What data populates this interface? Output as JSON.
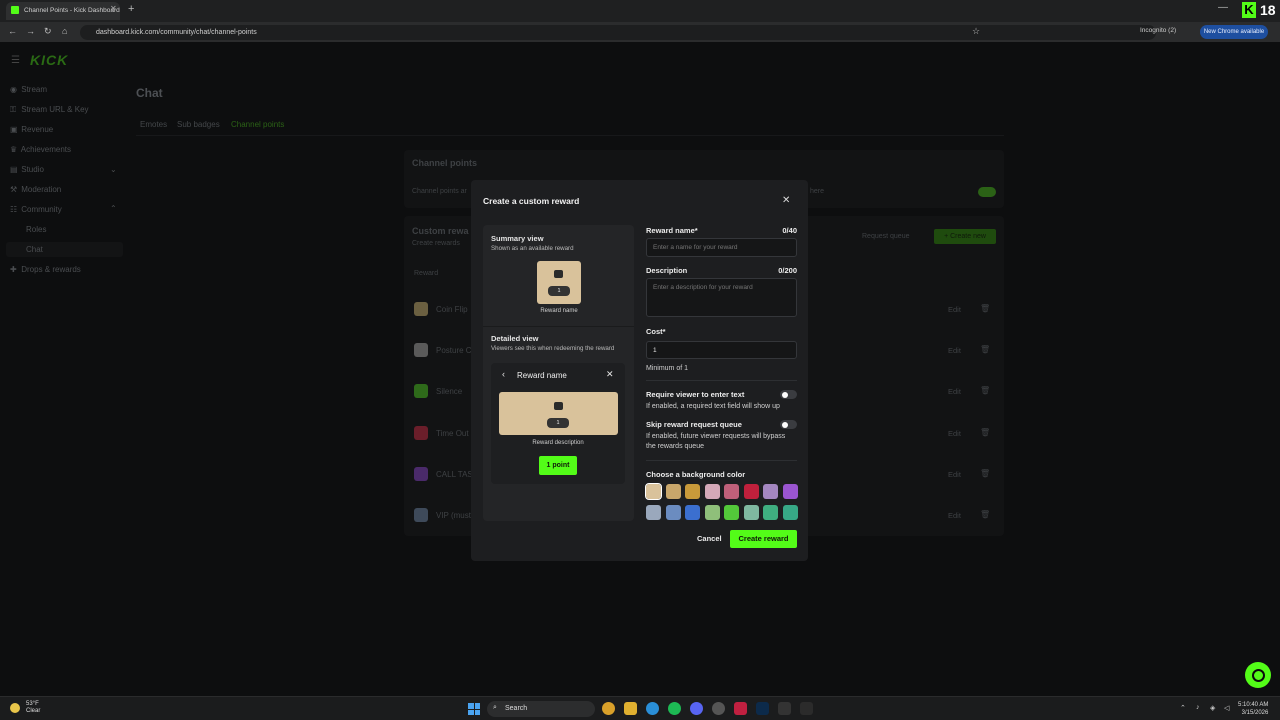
{
  "browser": {
    "tab_title": "Channel Points - Kick Dashboard",
    "url": "dashboard.kick.com/community/chat/channel-points",
    "incognito": "Incognito (2)",
    "update_button": "New Chrome available",
    "corner_badge_letter": "K",
    "corner_badge_number": "18"
  },
  "app": {
    "logo": "KICK",
    "page_title": "Chat",
    "sidebar": [
      {
        "label": "Stream",
        "icon": "broadcast-icon"
      },
      {
        "label": "Stream URL & Key",
        "icon": "key-icon"
      },
      {
        "label": "Revenue",
        "icon": "revenue-icon"
      },
      {
        "label": "Achievements",
        "icon": "trophy-icon"
      },
      {
        "label": "Studio",
        "icon": "studio-icon"
      },
      {
        "label": "Moderation",
        "icon": "gavel-icon"
      },
      {
        "label": "Community",
        "icon": "community-icon"
      },
      {
        "label": "Roles",
        "icon": ""
      },
      {
        "label": "Chat",
        "icon": ""
      },
      {
        "label": "Drops & rewards",
        "icon": "gift-icon"
      }
    ],
    "subtabs": [
      "Emotes",
      "Sub badges",
      "Channel points"
    ],
    "channel_points_title": "Channel points",
    "channel_points_desc_start": "Channel points ar",
    "channel_points_desc_end": "here",
    "custom_rewards_title": "Custom rewa",
    "custom_rewards_sub": "Create rewards",
    "reward_col": "Reward",
    "request_queue": "Request queue",
    "create_new": "+ Create new",
    "rewards": [
      {
        "name": "Coin Flip",
        "color": "#6b6041"
      },
      {
        "name": "Posture Ch",
        "color": "#5a5a5a"
      },
      {
        "name": "Silence",
        "color": "#2e6a1a"
      },
      {
        "name": "Time Out",
        "color": "#6a1e2a"
      },
      {
        "name": "CALL TAS",
        "color": "#4a2a6a"
      },
      {
        "name": "VIP (must",
        "color": "#3e4a5a"
      }
    ],
    "edit_label": "Edit"
  },
  "modal": {
    "title": "Create a custom reward",
    "summary_title": "Summary view",
    "summary_sub": "Shown as an available reward",
    "tile_cost": "1",
    "tile_caption": "Reward name",
    "detailed_title": "Detailed view",
    "detailed_sub": "Viewers see this when redeeming the reward",
    "detail_header": "Reward name",
    "detail_cost": "1",
    "detail_desc": "Reward description",
    "detail_button": "1 point",
    "name_label": "Reward name*",
    "name_count": "0/40",
    "name_placeholder": "Enter a name for your reward",
    "desc_label": "Description",
    "desc_count": "0/200",
    "desc_placeholder": "Enter a description for your reward",
    "cost_label": "Cost*",
    "cost_value": "1",
    "cost_help": "Minimum of 1",
    "require_label": "Require viewer to enter text",
    "require_help": "If enabled, a required text field will show up",
    "skip_label": "Skip reward request queue",
    "skip_help_1": "If enabled, future viewer requests will bypass",
    "skip_help_2": "the rewards queue",
    "color_label": "Choose a background color",
    "colors_row1": [
      "#d9c29b",
      "#c9a76b",
      "#c99a3a",
      "#d4a8b8",
      "#c0607a",
      "#c0203c",
      "#a487c0",
      "#9a55d0"
    ],
    "colors_row2": [
      "#9aa8bc",
      "#6b8cc0",
      "#3b6fcf",
      "#8fbf7a",
      "#53c83a",
      "#7fb8a0",
      "#3fae80",
      "#37a886"
    ],
    "cancel": "Cancel",
    "create": "Create reward",
    "accent": "#53fc18"
  },
  "taskbar": {
    "temp": "53°F",
    "weather": "Clear",
    "search": "Search",
    "time": "5:10:40 AM",
    "date": "3/15/2026"
  }
}
